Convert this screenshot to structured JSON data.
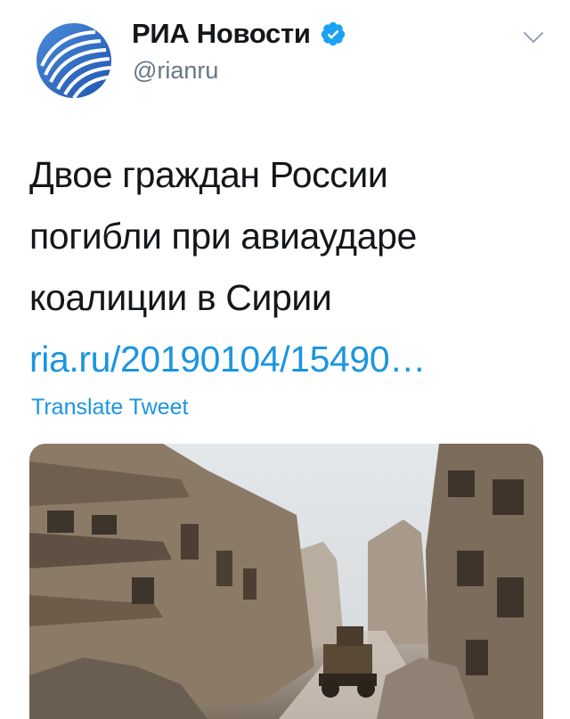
{
  "account": {
    "display_name": "РИА Новости",
    "handle": "@rianru",
    "avatar_icon": "ria-logo-icon",
    "verified_icon": "verified-badge-icon"
  },
  "menu_icon": "chevron-down-icon",
  "tweet": {
    "text_lines": [
      "Двое граждан России",
      "погибли при авиаударе",
      "коалиции в Сирии"
    ],
    "link": "ria.ru/20190104/15490…",
    "translate_label": "Translate Tweet"
  },
  "media": {
    "kind": "photo"
  },
  "colors": {
    "link": "#1b95e0",
    "verified": "#1da1f2",
    "secondary_text": "#657786",
    "logo_blue": "#2e6bc4"
  }
}
